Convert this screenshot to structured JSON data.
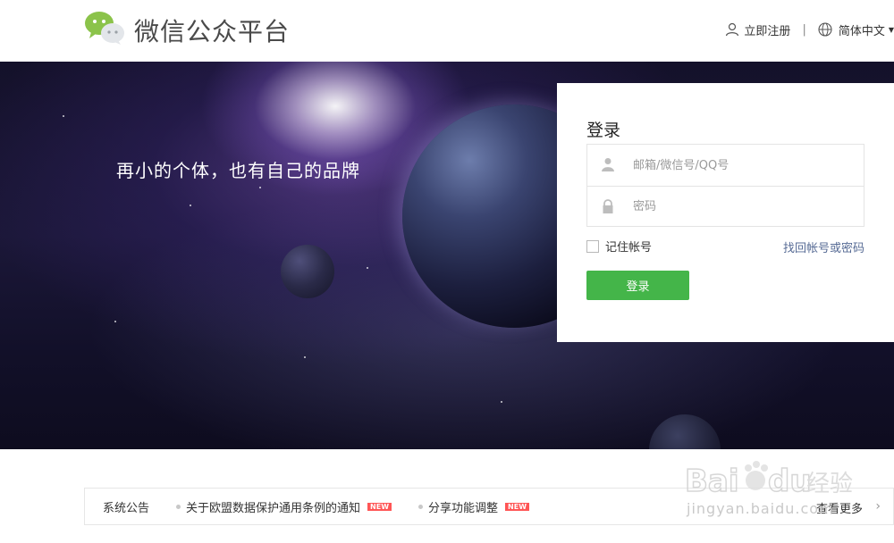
{
  "header": {
    "brand": "微信公众平台",
    "register_label": "立即注册",
    "separator": "|",
    "language_label": "简体中文"
  },
  "banner": {
    "tagline": "再小的个体，也有自己的品牌"
  },
  "login": {
    "title": "登录",
    "account_placeholder": "邮箱/微信号/QQ号",
    "password_placeholder": "密码",
    "remember_label": "记住帐号",
    "forgot_label": "找回帐号或密码",
    "submit_label": "登录"
  },
  "notice": {
    "title": "系统公告",
    "items": [
      {
        "label": "关于欧盟数据保护通用条例的通知",
        "badge": "NEW"
      },
      {
        "label": "分享功能调整",
        "badge": "NEW"
      }
    ],
    "more_label": "查看更多"
  },
  "watermark": {
    "text": "jingyan.baidu.com"
  },
  "colors": {
    "accent_green": "#44b549",
    "link_blue": "#576b95",
    "badge_red": "#ff5555"
  }
}
